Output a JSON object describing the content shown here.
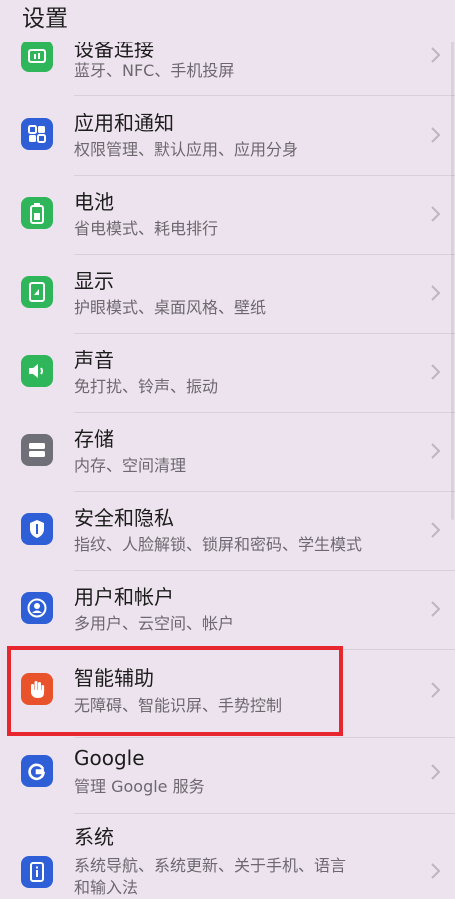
{
  "header": {
    "title": "设置"
  },
  "colors": {
    "green": "#2fb65a",
    "blue": "#2f5fd6",
    "gray": "#6f6f78",
    "orange": "#e8532b",
    "highlight": "#e8262e"
  },
  "items": [
    {
      "title": "设备连接",
      "subtitle": "蓝牙、NFC、手机投屏",
      "icon": "device-connection-icon"
    },
    {
      "title": "应用和通知",
      "subtitle": "权限管理、默认应用、应用分身",
      "icon": "apps-grid-icon"
    },
    {
      "title": "电池",
      "subtitle": "省电模式、耗电排行",
      "icon": "battery-icon"
    },
    {
      "title": "显示",
      "subtitle": "护眼模式、桌面风格、壁纸",
      "icon": "display-icon"
    },
    {
      "title": "声音",
      "subtitle": "免打扰、铃声、振动",
      "icon": "speaker-icon"
    },
    {
      "title": "存储",
      "subtitle": "内存、空间清理",
      "icon": "storage-icon"
    },
    {
      "title": "安全和隐私",
      "subtitle": "指纹、人脸解锁、锁屏和密码、学生模式",
      "icon": "shield-icon"
    },
    {
      "title": "用户和帐户",
      "subtitle": "多用户、云空间、帐户",
      "icon": "user-icon"
    },
    {
      "title": "智能辅助",
      "subtitle": "无障碍、智能识屏、手势控制",
      "icon": "hand-icon"
    },
    {
      "title": "Google",
      "subtitle": "管理 Google 服务",
      "icon": "google-icon"
    },
    {
      "title": "系统",
      "subtitle": "系统导航、系统更新、关于手机、语言",
      "subtitle2": "和输入法",
      "icon": "system-info-icon"
    }
  ]
}
